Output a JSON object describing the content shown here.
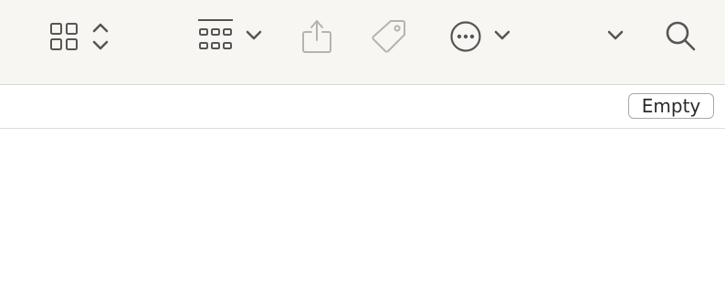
{
  "colors": {
    "toolbar_bg": "#f8f6f2",
    "icon_dark": "#555555",
    "icon_disabled": "#b5b3b0"
  },
  "toolbar": {
    "view_mode_icon": "grid-view-icon",
    "view_mode_stepper_icon": "up-down-chevron-icon",
    "group_icon": "group-by-grid-icon",
    "group_chevron_icon": "chevron-down-icon",
    "share_icon": "share-icon",
    "tag_icon": "tag-icon",
    "more_icon": "ellipsis-circle-icon",
    "more_chevron_icon": "chevron-down-icon",
    "overflow_chevron_icon": "chevron-down-icon",
    "search_icon": "search-icon"
  },
  "trash_bar": {
    "empty_label": "Empty"
  }
}
